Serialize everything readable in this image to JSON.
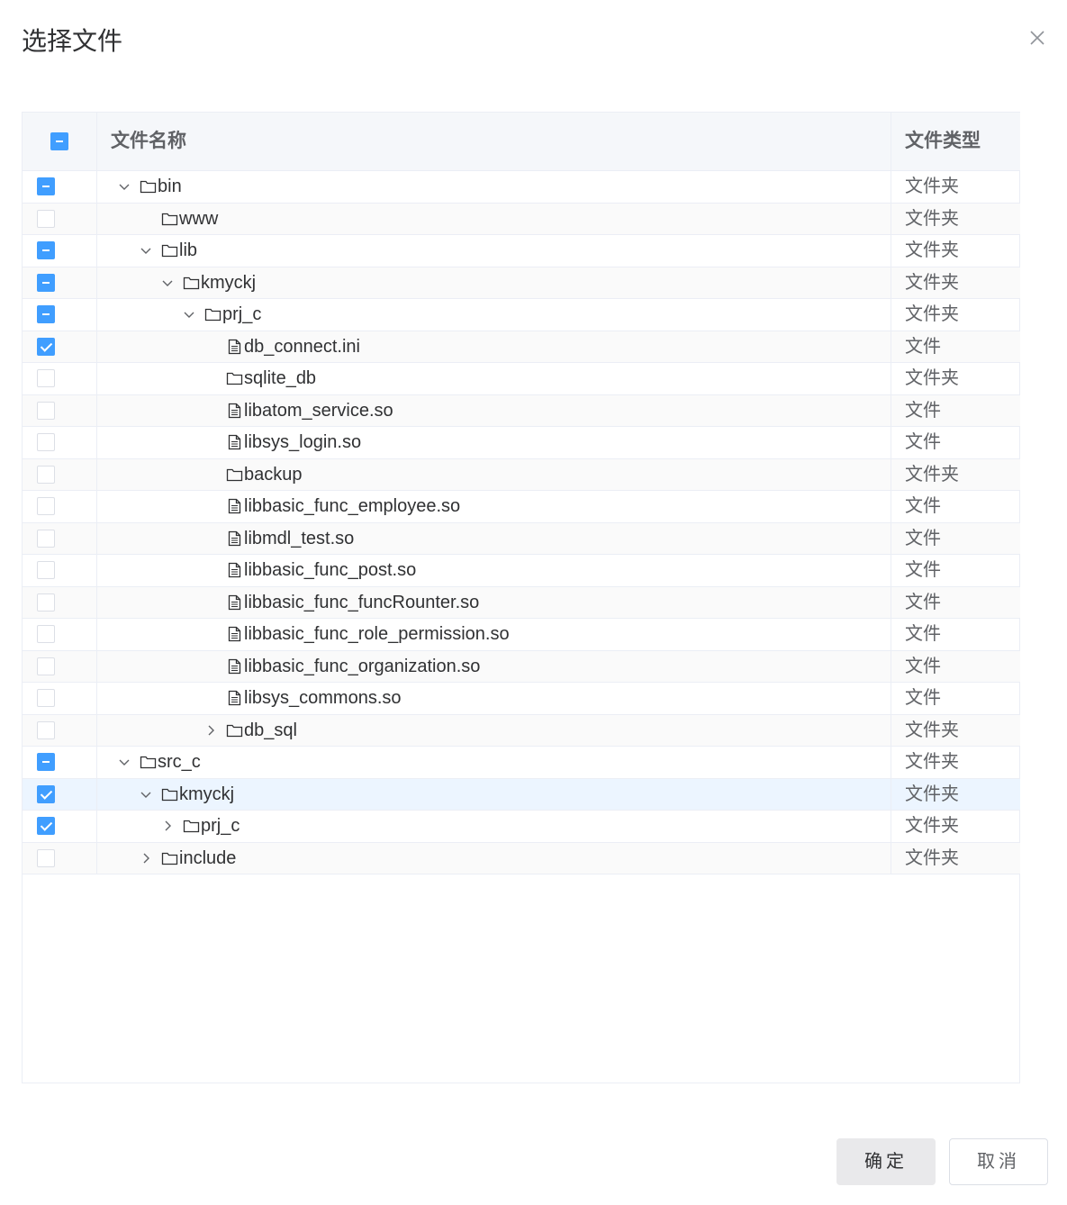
{
  "dialog": {
    "title": "选择文件",
    "close_icon": "close-icon"
  },
  "table": {
    "headers": {
      "name": "文件名称",
      "type": "文件类型"
    },
    "header_check": "indeterminate",
    "rows": [
      {
        "name": "bin",
        "type": "文件夹",
        "kind": "folder",
        "level": 0,
        "expand": "expanded",
        "check": "indeterminate"
      },
      {
        "name": "www",
        "type": "文件夹",
        "kind": "folder",
        "level": 1,
        "expand": "none",
        "check": "unchecked"
      },
      {
        "name": "lib",
        "type": "文件夹",
        "kind": "folder",
        "level": 1,
        "expand": "expanded",
        "check": "indeterminate"
      },
      {
        "name": "kmyckj",
        "type": "文件夹",
        "kind": "folder",
        "level": 2,
        "expand": "expanded",
        "check": "indeterminate"
      },
      {
        "name": "prj_c",
        "type": "文件夹",
        "kind": "folder",
        "level": 3,
        "expand": "expanded",
        "check": "indeterminate"
      },
      {
        "name": "db_connect.ini",
        "type": "文件",
        "kind": "file",
        "level": 4,
        "expand": "none",
        "check": "checked"
      },
      {
        "name": "sqlite_db",
        "type": "文件夹",
        "kind": "folder",
        "level": 4,
        "expand": "none",
        "check": "unchecked"
      },
      {
        "name": "libatom_service.so",
        "type": "文件",
        "kind": "file",
        "level": 4,
        "expand": "none",
        "check": "unchecked"
      },
      {
        "name": "libsys_login.so",
        "type": "文件",
        "kind": "file",
        "level": 4,
        "expand": "none",
        "check": "unchecked"
      },
      {
        "name": "backup",
        "type": "文件夹",
        "kind": "folder",
        "level": 4,
        "expand": "none",
        "check": "unchecked"
      },
      {
        "name": "libbasic_func_employee.so",
        "type": "文件",
        "kind": "file",
        "level": 4,
        "expand": "none",
        "check": "unchecked"
      },
      {
        "name": "libmdl_test.so",
        "type": "文件",
        "kind": "file",
        "level": 4,
        "expand": "none",
        "check": "unchecked"
      },
      {
        "name": "libbasic_func_post.so",
        "type": "文件",
        "kind": "file",
        "level": 4,
        "expand": "none",
        "check": "unchecked"
      },
      {
        "name": "libbasic_func_funcRounter.so",
        "type": "文件",
        "kind": "file",
        "level": 4,
        "expand": "none",
        "check": "unchecked"
      },
      {
        "name": "libbasic_func_role_permission.so",
        "type": "文件",
        "kind": "file",
        "level": 4,
        "expand": "none",
        "check": "unchecked"
      },
      {
        "name": "libbasic_func_organization.so",
        "type": "文件",
        "kind": "file",
        "level": 4,
        "expand": "none",
        "check": "unchecked"
      },
      {
        "name": "libsys_commons.so",
        "type": "文件",
        "kind": "file",
        "level": 4,
        "expand": "none",
        "check": "unchecked"
      },
      {
        "name": "db_sql",
        "type": "文件夹",
        "kind": "folder",
        "level": 4,
        "expand": "collapsed",
        "check": "unchecked"
      },
      {
        "name": "src_c",
        "type": "文件夹",
        "kind": "folder",
        "level": 0,
        "expand": "expanded",
        "check": "indeterminate"
      },
      {
        "name": "kmyckj",
        "type": "文件夹",
        "kind": "folder",
        "level": 1,
        "expand": "expanded",
        "check": "checked",
        "highlight": true
      },
      {
        "name": "prj_c",
        "type": "文件夹",
        "kind": "folder",
        "level": 2,
        "expand": "collapsed",
        "check": "checked"
      },
      {
        "name": "include",
        "type": "文件夹",
        "kind": "folder",
        "level": 1,
        "expand": "collapsed",
        "check": "unchecked"
      }
    ]
  },
  "footer": {
    "ok_label": "确定",
    "cancel_label": "取消"
  },
  "colors": {
    "primary": "#409eff",
    "row_highlight": "#ecf5ff",
    "border": "#ebeef5"
  }
}
